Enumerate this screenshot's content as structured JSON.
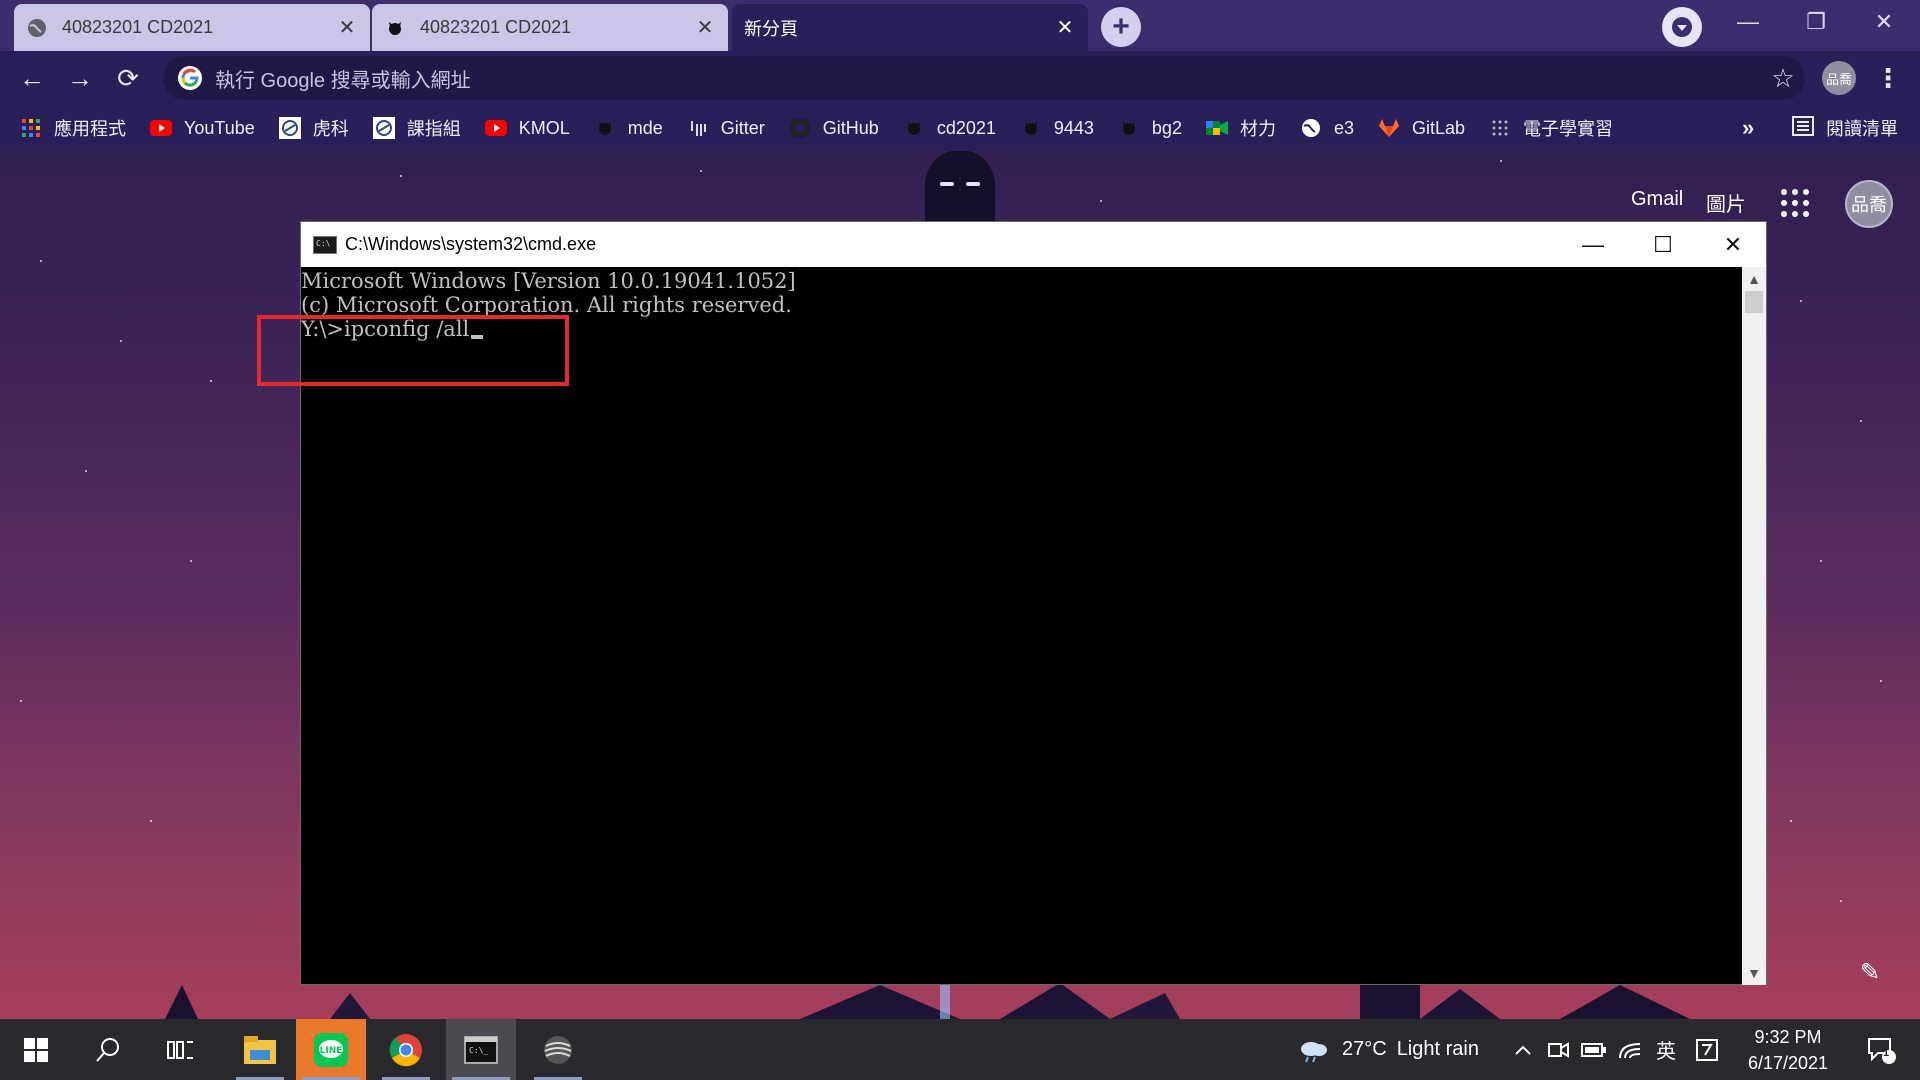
{
  "browser": {
    "tabs": [
      {
        "label": "40823201 CD2021",
        "icon": "globe-icon"
      },
      {
        "label": "40823201 CD2021",
        "icon": "github-octocat-icon"
      },
      {
        "label": "新分頁",
        "icon": "none"
      }
    ],
    "omnibox_placeholder": "執行 Google 搜尋或輸入網址",
    "profile_initials": "品喬",
    "bookmarks": [
      {
        "label": "應用程式",
        "icon": "apps-grid-icon",
        "color": "#e8453c"
      },
      {
        "label": "YouTube",
        "icon": "youtube-icon",
        "color": "#ff0000"
      },
      {
        "label": "虎科",
        "icon": "nfu-icon",
        "color": "#ffffff"
      },
      {
        "label": "課指組",
        "icon": "nfu-icon",
        "color": "#ffffff"
      },
      {
        "label": "KMOL",
        "icon": "youtube-icon",
        "color": "#ff0000"
      },
      {
        "label": "mde",
        "icon": "github-octocat-icon",
        "color": "#111111"
      },
      {
        "label": "Gitter",
        "icon": "gitter-icon",
        "color": "#dddddd"
      },
      {
        "label": "GitHub",
        "icon": "github-icon",
        "color": "#222222"
      },
      {
        "label": "cd2021",
        "icon": "github-octocat-icon",
        "color": "#111111"
      },
      {
        "label": "9443",
        "icon": "github-octocat-icon",
        "color": "#111111"
      },
      {
        "label": "bg2",
        "icon": "github-octocat-icon",
        "color": "#111111"
      },
      {
        "label": "材力",
        "icon": "meet-icon",
        "color": "#34a853"
      },
      {
        "label": "e3",
        "icon": "globe-icon",
        "color": "#ffffff"
      },
      {
        "label": "GitLab",
        "icon": "gitlab-icon",
        "color": "#fc6d26"
      },
      {
        "label": "電子學實習",
        "icon": "dots-icon",
        "color": "#cccccc"
      }
    ],
    "bookmarks_overflow": "»",
    "reading_list": "閱讀清單"
  },
  "ntp": {
    "gmail": "Gmail",
    "images": "圖片",
    "profile_initials": "品喬"
  },
  "cmd": {
    "title": "C:\\Windows\\system32\\cmd.exe",
    "lines": [
      "Microsoft Windows [Version 10.0.19041.1052]",
      "(c) Microsoft Corporation. All rights reserved.",
      "",
      "Y:\\>ipconfig /all"
    ],
    "highlight_color": "#e52a2a"
  },
  "taskbar": {
    "weather_temp": "27°C",
    "weather_text": "Light rain",
    "ime": "英",
    "time": "9:32 PM",
    "date": "6/17/2021",
    "notification_count": "1",
    "pinned": [
      {
        "name": "windows-start-icon"
      },
      {
        "name": "search-icon"
      },
      {
        "name": "task-view-icon"
      },
      {
        "name": "file-explorer-icon"
      },
      {
        "name": "line-app-icon"
      },
      {
        "name": "chrome-icon"
      },
      {
        "name": "cmd-icon"
      },
      {
        "name": "app-sphere-icon"
      }
    ]
  }
}
